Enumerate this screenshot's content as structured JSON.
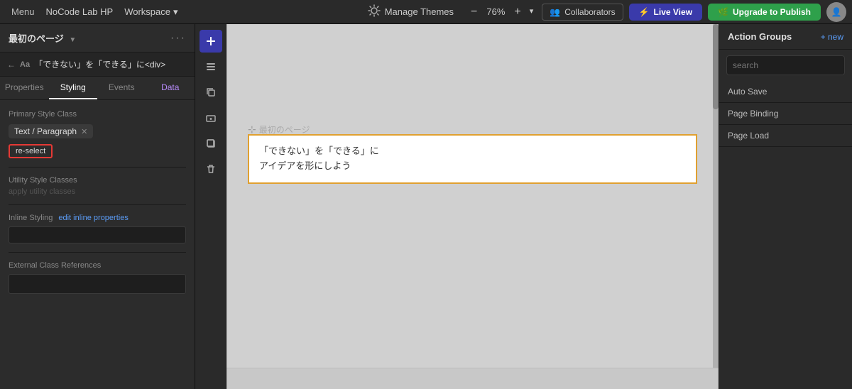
{
  "topbar": {
    "menu_label": "Menu",
    "site_name": "NoCode Lab HP",
    "workspace_label": "Workspace",
    "manage_themes_label": "Manage Themes",
    "zoom_level": "76%",
    "zoom_decrease": "−",
    "zoom_increase": "+",
    "collaborators_label": "Collaborators",
    "live_view_label": "Live View",
    "publish_label": "Upgrade to Publish"
  },
  "left_panel": {
    "page_title": "最初のページ",
    "page_title_arrow": "▼",
    "breadcrumb_element": "「できない」を「できる」に<div>",
    "tabs": [
      {
        "label": "Properties",
        "active": false
      },
      {
        "label": "Styling",
        "active": true
      },
      {
        "label": "Events",
        "active": false
      },
      {
        "label": "Data",
        "active": false,
        "colored": true
      }
    ],
    "primary_style_class_label": "Primary Style Class",
    "style_tag_label": "Text / Paragraph",
    "re_select_label": "re-select",
    "utility_style_label": "Utility Style Classes",
    "utility_placeholder": "apply utility classes",
    "inline_styling_label": "Inline Styling",
    "inline_edit_link": "edit inline properties",
    "external_class_label": "External Class References"
  },
  "canvas": {
    "page_label": "最初のページ",
    "content_line1": "「できない」を「できる」に",
    "content_line2": "アイデアを形にしよう"
  },
  "right_panel": {
    "title": "Action Groups",
    "new_label": "+ new",
    "search_placeholder": "search",
    "items": [
      {
        "label": "Auto Save"
      },
      {
        "label": "Page Binding"
      },
      {
        "label": "Page Load"
      }
    ]
  }
}
